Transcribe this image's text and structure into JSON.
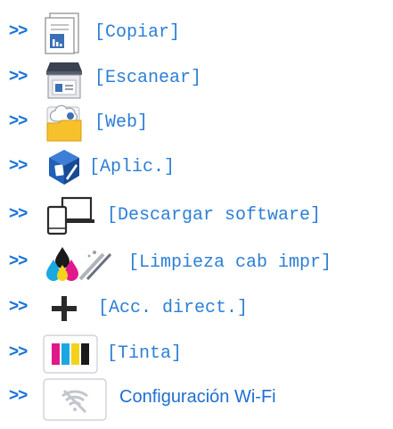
{
  "arrow": ">>",
  "items": [
    {
      "label": "[Copiar]",
      "icon": "copy-icon"
    },
    {
      "label": "[Escanear]",
      "icon": "scanner-icon"
    },
    {
      "label": "[Web]",
      "icon": "web-folder-icon"
    },
    {
      "label": "[Aplic.]",
      "icon": "apps-cube-icon"
    },
    {
      "label": "[Descargar software]",
      "icon": "devices-icon"
    },
    {
      "label": "[Limpieza cab impr]",
      "icon": "head-cleaning-icon"
    },
    {
      "label": "[Acc. direct.]",
      "icon": "plus-icon"
    },
    {
      "label": "[Tinta]",
      "icon": "ink-icon"
    },
    {
      "label": "Configuración Wi-Fi",
      "icon": "wifi-icon"
    }
  ],
  "colors": {
    "link": "#1f6fd0",
    "arrow": "#1a73d8"
  }
}
